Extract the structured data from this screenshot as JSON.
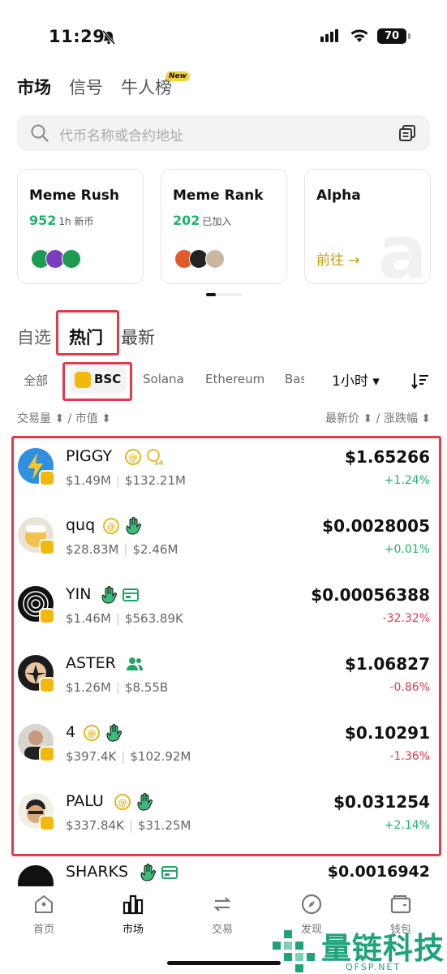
{
  "status_bar": {
    "time": "11:29",
    "battery": "70"
  },
  "top_tabs": [
    {
      "label": "市场",
      "active": true
    },
    {
      "label": "信号",
      "active": false
    },
    {
      "label": "牛人榜",
      "active": false
    }
  ],
  "new_badge": "New",
  "search": {
    "placeholder": "代币名称或合约地址"
  },
  "cards": [
    {
      "title": "Meme Rush",
      "count": "952",
      "subtitle": "1h 新币"
    },
    {
      "title": "Meme Rank",
      "count": "202",
      "subtitle": "已加入"
    },
    {
      "title": "Alpha",
      "link": "前往 →"
    }
  ],
  "list_tabs": [
    {
      "label": "自选",
      "active": false
    },
    {
      "label": "热门",
      "active": true
    },
    {
      "label": "最新",
      "active": false
    }
  ],
  "chains": [
    "全部",
    "BSC",
    "Solana",
    "Ethereum",
    "Bas"
  ],
  "time_filter": "1小时 ▾",
  "sort": {
    "left": "交易量 ⬍ / 市值 ⬍",
    "right": "最新价 ⬍ / 涨跌幅 ⬍"
  },
  "tokens": [
    {
      "symbol": "PIGGY",
      "volume": "$1.49M",
      "mcap": "$132.21M",
      "price": "$1.65266",
      "change": "+1.24%"
    },
    {
      "symbol": "quq",
      "volume": "$28.83M",
      "mcap": "$2.46M",
      "price": "$0.0028005",
      "change": "+0.01%"
    },
    {
      "symbol": "YIN",
      "volume": "$1.46M",
      "mcap": "$563.89K",
      "price": "$0.00056388",
      "change": "-32.32%"
    },
    {
      "symbol": "ASTER",
      "volume": "$1.26M",
      "mcap": "$8.55B",
      "price": "$1.06827",
      "change": "-0.86%"
    },
    {
      "symbol": "4",
      "volume": "$397.4K",
      "mcap": "$102.92M",
      "price": "$0.10291",
      "change": "-1.36%"
    },
    {
      "symbol": "PALU",
      "volume": "$337.84K",
      "mcap": "$31.25M",
      "price": "$0.031254",
      "change": "+2.14%"
    }
  ],
  "partial_token": {
    "symbol": "SHARKS",
    "price": "$0.0016942"
  },
  "bottom_nav": [
    {
      "label": "首页",
      "icon": "home-icon"
    },
    {
      "label": "市场",
      "icon": "market-icon",
      "active": true
    },
    {
      "label": "交易",
      "icon": "trade-icon"
    },
    {
      "label": "发现",
      "icon": "compass-icon"
    },
    {
      "label": "钱包",
      "icon": "wallet-icon"
    }
  ],
  "watermark": {
    "text": "量链科技",
    "url": "QFSP.NET"
  },
  "colors": {
    "up": "#20b26c",
    "down": "#e03a4b",
    "accent": "#f0b90b",
    "highlight_box": "#e03a4b"
  }
}
